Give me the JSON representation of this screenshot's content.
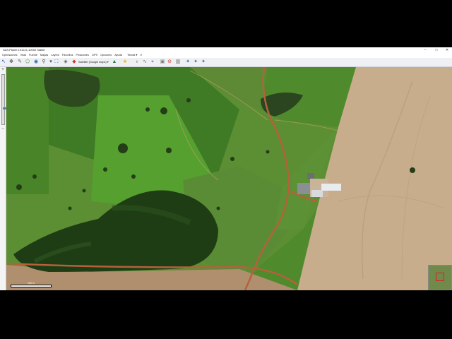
{
  "window": {
    "title": "SAS.Planet 191221.10000 Stable",
    "controls": [
      "–",
      "□",
      "✕"
    ]
  },
  "menu": {
    "items": [
      "Operaciones",
      "Vista",
      "Fuente",
      "Mapas",
      "Layers",
      "Favoritos",
      "Posiciones",
      "GPS",
      "Opciones",
      "Ayuda"
    ],
    "tienda_label": "Tienda ▾"
  },
  "toolbar": {
    "map_source_label": "Satellite (Google maps) ▾"
  },
  "map": {
    "scale_label": "100 m"
  },
  "colors": {
    "titlebar": "#ffffff",
    "toolbar": "#eef0f3",
    "field_green": "#4f8a2c",
    "forest": "#1f3d14",
    "bare_soil": "#c8ad8c",
    "road": "#b5613c"
  }
}
